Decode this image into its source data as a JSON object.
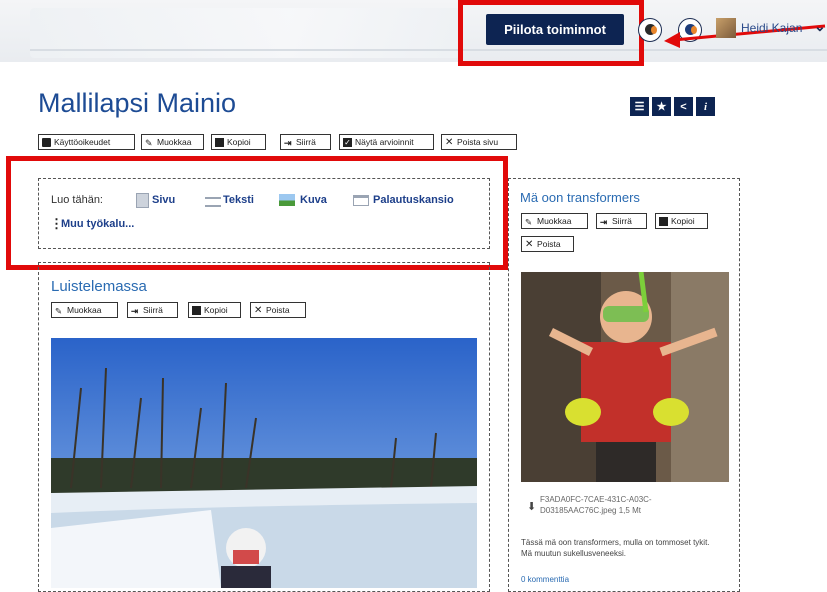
{
  "header": {
    "hide_tools_label": "Piilota toiminnot",
    "username": "Heidi Kajan"
  },
  "page": {
    "title": "Mallilapsi Mainio",
    "actions": [
      "Käyttöoikeudet",
      "Muokkaa",
      "Kopioi",
      "Siirrä",
      "Näytä arvioinnit",
      "Poista sivu"
    ]
  },
  "create": {
    "label": "Luo tähän:",
    "tools": [
      "Sivu",
      "Teksti",
      "Kuva",
      "Palautuskansio"
    ],
    "more": "Muu työkalu..."
  },
  "left_block": {
    "title": "Luistelemassa",
    "actions": [
      "Muokkaa",
      "Siirrä",
      "Kopioi",
      "Poista"
    ]
  },
  "right_block": {
    "title": "Mä oon transformers",
    "actions": [
      "Muokkaa",
      "Siirrä",
      "Kopioi",
      "Poista"
    ],
    "file_line1": "F3ADA0FC-7CAE-431C-A03C-",
    "file_line2": "D03185AAC76C.jpeg 1,5 Mt",
    "description": "Tässä mä oon transformers, mulla on tommoset tykit. Mä muutun sukellusveneeksi.",
    "comments": "0 kommenttia"
  },
  "colors": {
    "primary": "#0d2452",
    "highlight": "#e10a0a",
    "link": "#2a6bb2"
  }
}
